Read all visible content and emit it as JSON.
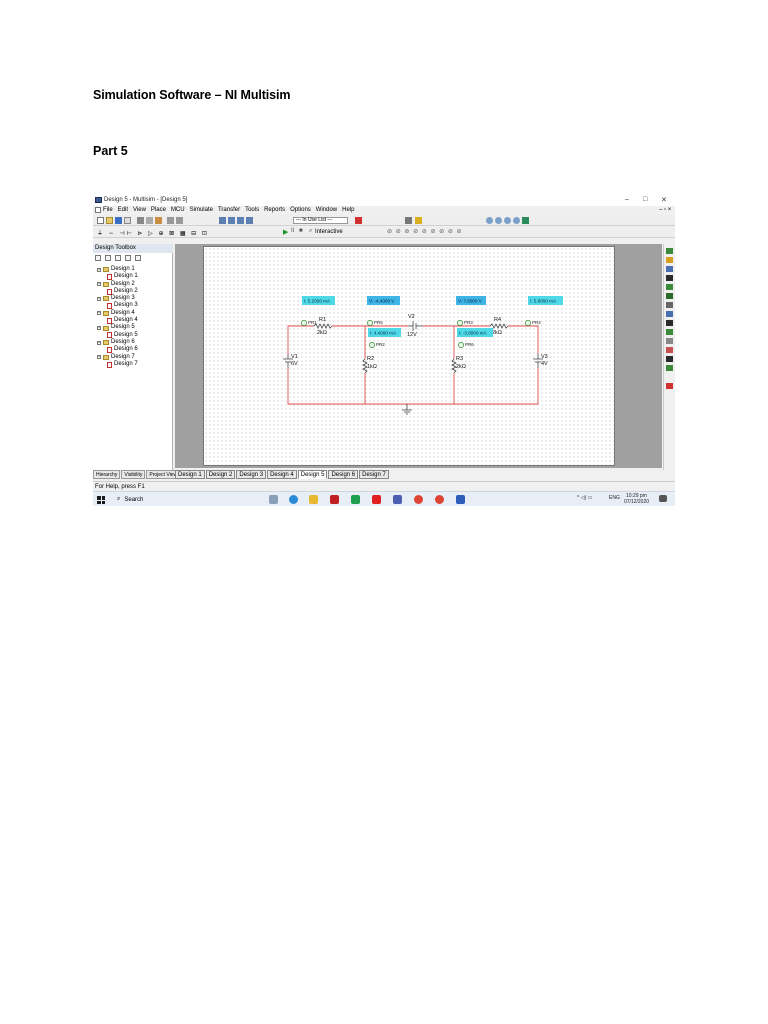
{
  "document": {
    "heading": "Simulation Software – NI Multisim",
    "part": "Part 5"
  },
  "window": {
    "title": "Design 5 - Multisim - [Design 5]",
    "controls": [
      "–",
      "□",
      "✕"
    ]
  },
  "menu": [
    "File",
    "Edit",
    "View",
    "Place",
    "MCU",
    "Simulate",
    "Transfer",
    "Tools",
    "Reports",
    "Options",
    "Window",
    "Help"
  ],
  "toolbar": {
    "in_use_list": "--- In Use List ---",
    "interactive": "Interactive"
  },
  "toolbox": {
    "title": "Design Toolbox",
    "tree": [
      {
        "folder": "Design 1",
        "file": "Design 1"
      },
      {
        "folder": "Design 2",
        "file": "Design 2"
      },
      {
        "folder": "Design 3",
        "file": "Design 3"
      },
      {
        "folder": "Design 4",
        "file": "Design 4"
      },
      {
        "folder": "Design 5",
        "file": "Design 5"
      },
      {
        "folder": "Design 6",
        "file": "Design 6"
      },
      {
        "folder": "Design 7",
        "file": "Design 7"
      }
    ],
    "tabs": [
      "Hierarchy",
      "Visibility",
      "Project View"
    ]
  },
  "design_tabs": [
    "Design 1",
    "Design 2",
    "Design 3",
    "Design 4",
    "Design 5",
    "Design 6",
    "Design 7"
  ],
  "active_design_tab": 4,
  "circuit": {
    "probes": {
      "pr1": {
        "label": "PR1",
        "reading": "I: 5.2000 mA"
      },
      "pr5": {
        "label": "PR5",
        "reading": "V: -4.4000 V"
      },
      "pr2": {
        "label": "PR2",
        "reading": "I: 4.4000 mA"
      },
      "pr3": {
        "label": "PR3",
        "reading": "V: 7.6000 V"
      },
      "pr4": {
        "label": "PR4",
        "reading": "I: 5.8000 mA"
      },
      "pr6": {
        "label": "PR6",
        "reading": "I: -3.8000 mA"
      }
    },
    "components": {
      "r1": {
        "name": "R1",
        "value": "2kΩ"
      },
      "r2": {
        "name": "R2",
        "value": "1kΩ"
      },
      "r3": {
        "name": "R3",
        "value": "2kΩ"
      },
      "r4": {
        "name": "R4",
        "value": "2kΩ"
      },
      "v1": {
        "name": "V1",
        "value": "6V"
      },
      "v2": {
        "name": "V2",
        "value": "12V"
      },
      "v3": {
        "name": "V3",
        "value": "4V"
      }
    },
    "colors": {
      "wire": "#e05050",
      "probe_box": "#4fd8e8",
      "probe_box_dark": "#3fb4e6"
    }
  },
  "status": "For Help, press F1",
  "taskbar": {
    "search": "Search",
    "tray_lang": "ENG",
    "time": "10:29 pm",
    "date": "07/12/2020"
  }
}
